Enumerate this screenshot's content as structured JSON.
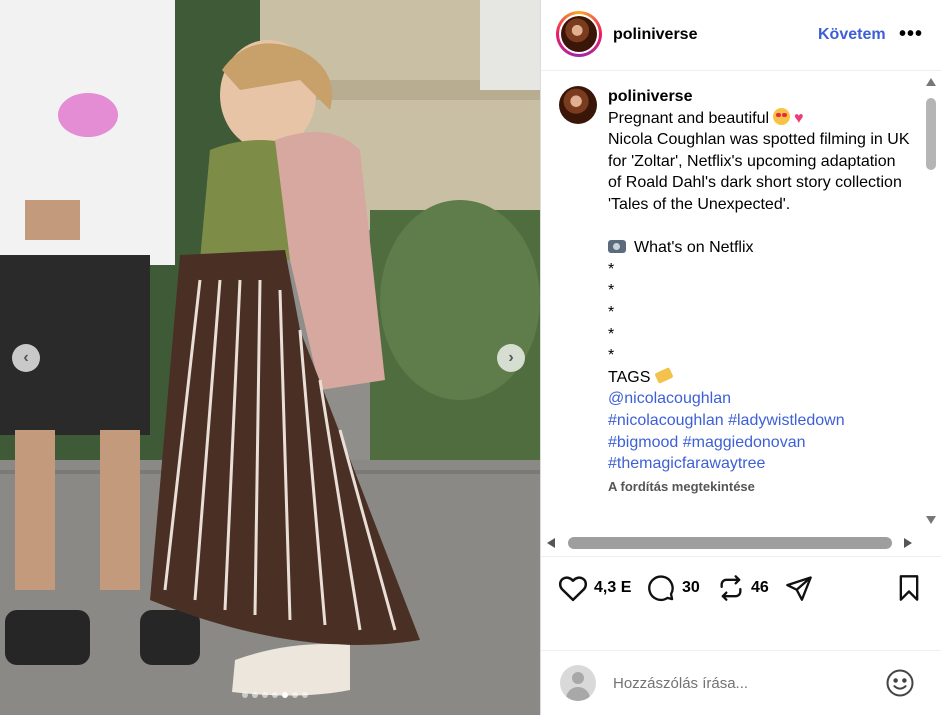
{
  "post": {
    "username": "poliniverse",
    "follow_label": "Követem",
    "more_label": "•••"
  },
  "caption": {
    "username": "poliniverse",
    "lines": [
      "Pregnant and beautiful",
      "Nicola Coughlan was spotted filming in UK for 'Zoltar', Netflix's upcoming adaptation of Roald Dahl's dark short story collection 'Tales of the Unexpected'.",
      "",
      "What's on Netflix",
      "*",
      "*",
      "*",
      "*",
      "*",
      "TAGS"
    ],
    "tags": [
      "@nicolacoughlan",
      "#nicolacoughlan #ladywistledown",
      "#bigmood #maggiedonovan",
      "#themagicfarawaytree"
    ],
    "translate_label": "A fordítás megtekintése"
  },
  "actions": {
    "likes": "4,3 E",
    "comments": "30",
    "reposts": "46"
  },
  "comment_box": {
    "placeholder": "Hozzászólás írása..."
  },
  "carousel": {
    "prev_label": "‹",
    "next_label": "›",
    "slide_count": 7,
    "active_index": 4
  },
  "icons": {
    "like": "heart-icon",
    "comment": "comment-bubble-icon",
    "repost": "repost-icon",
    "share": "send-icon",
    "save": "bookmark-icon",
    "emoji": "smiley-icon"
  },
  "colors": {
    "link": "#3d5fd6",
    "scroll_thumb": "#9e9e9e"
  }
}
